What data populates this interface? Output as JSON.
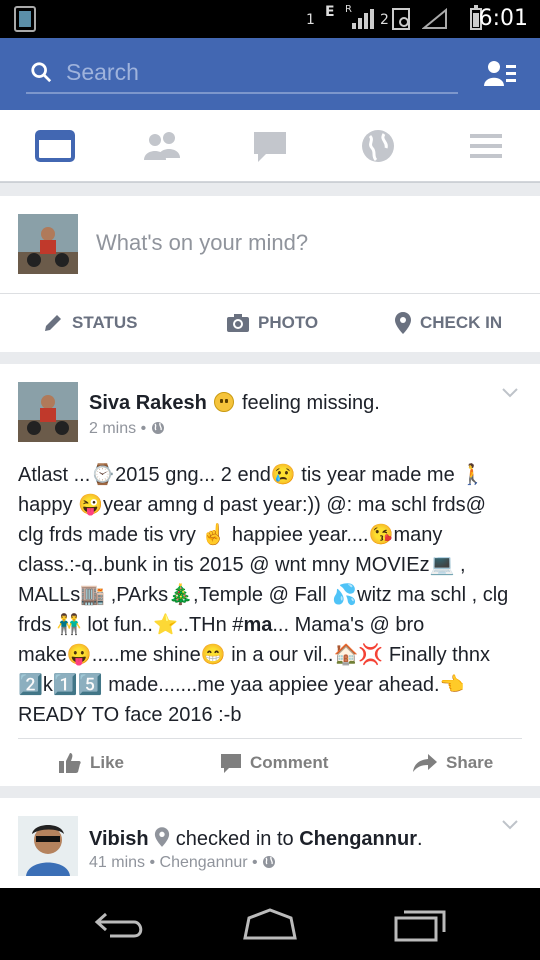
{
  "status_bar": {
    "sim1": "1",
    "network": "E",
    "roaming": "R",
    "sim2": "2",
    "time": "6:01"
  },
  "search": {
    "placeholder": "Search"
  },
  "tabs": [
    {
      "name": "news-feed",
      "active": true
    },
    {
      "name": "friends",
      "active": false
    },
    {
      "name": "messages",
      "active": false
    },
    {
      "name": "notifications",
      "active": false
    },
    {
      "name": "menu",
      "active": false
    }
  ],
  "composer": {
    "prompt": "What's on your mind?",
    "actions": {
      "status": "STATUS",
      "photo": "PHOTO",
      "checkin": "CHECK IN"
    }
  },
  "post": {
    "author": "Siva Rakesh",
    "feeling": "feeling missing.",
    "time": "2 mins",
    "privacy_icon": "globe-icon",
    "lines": [
      "Atlast ...⌚2015 gng... 2  end😢 tis year made me 🚶",
      "happy 😜year amng d past year:)) @: ma schl frds@",
      "clg frds made tis vry ☝ happiee  year....😘many",
      "class.:-q..bunk in tis 2015  @ wnt mny MOVIEz💻 ,",
      "MALLs🏬 ,PArks🎄,Temple @ Fall 💦witz ma schl ,  clg",
      "frds 👬 lot fun..⭐..THn #ma... Mama's @ bro",
      "make😛.....me shine😁 in a our vil..🏠💢   Finally thnx",
      "2️⃣k1️⃣5️⃣  made.......me yaa appiee year ahead.👈",
      "READY TO face 2016  :-b"
    ],
    "bold_fragment": "ma",
    "actions": {
      "like": "Like",
      "comment": "Comment",
      "share": "Share"
    }
  },
  "post2": {
    "author": "Vibish",
    "checked_in_text": "checked in to",
    "place": "Chengannur",
    "place_suffix": ".",
    "time": "41 mins",
    "location": "Chengannur"
  },
  "colors": {
    "brand": "#4267b2",
    "background": "#e9ebee",
    "text": "#1d2129",
    "secondary_text": "#90949c"
  }
}
